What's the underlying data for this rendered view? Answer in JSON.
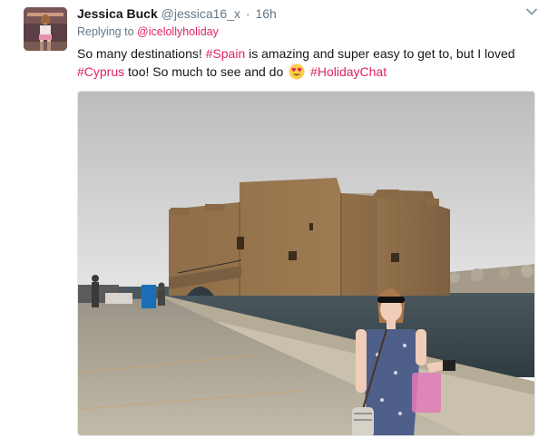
{
  "tweet": {
    "author_name": "Jessica Buck",
    "author_handle": "@jessica16_x",
    "separator": "·",
    "timestamp": "16h",
    "replying_prefix": "Replying to",
    "replying_to": "@icelollyholiday",
    "text_part1": "So many destinations! ",
    "hashtag1": "#Spain",
    "text_part2": " is amazing and super easy to get to, but I loved ",
    "hashtag2": "#Cyprus",
    "text_part3": " too! So much to see and do ",
    "emoji": "heart-eyes-emoji",
    "hashtag3": "#HolidayChat",
    "caret_icon": "chevron-down-icon"
  },
  "colors": {
    "hashtag": "#e0245e",
    "muted": "#657786"
  }
}
